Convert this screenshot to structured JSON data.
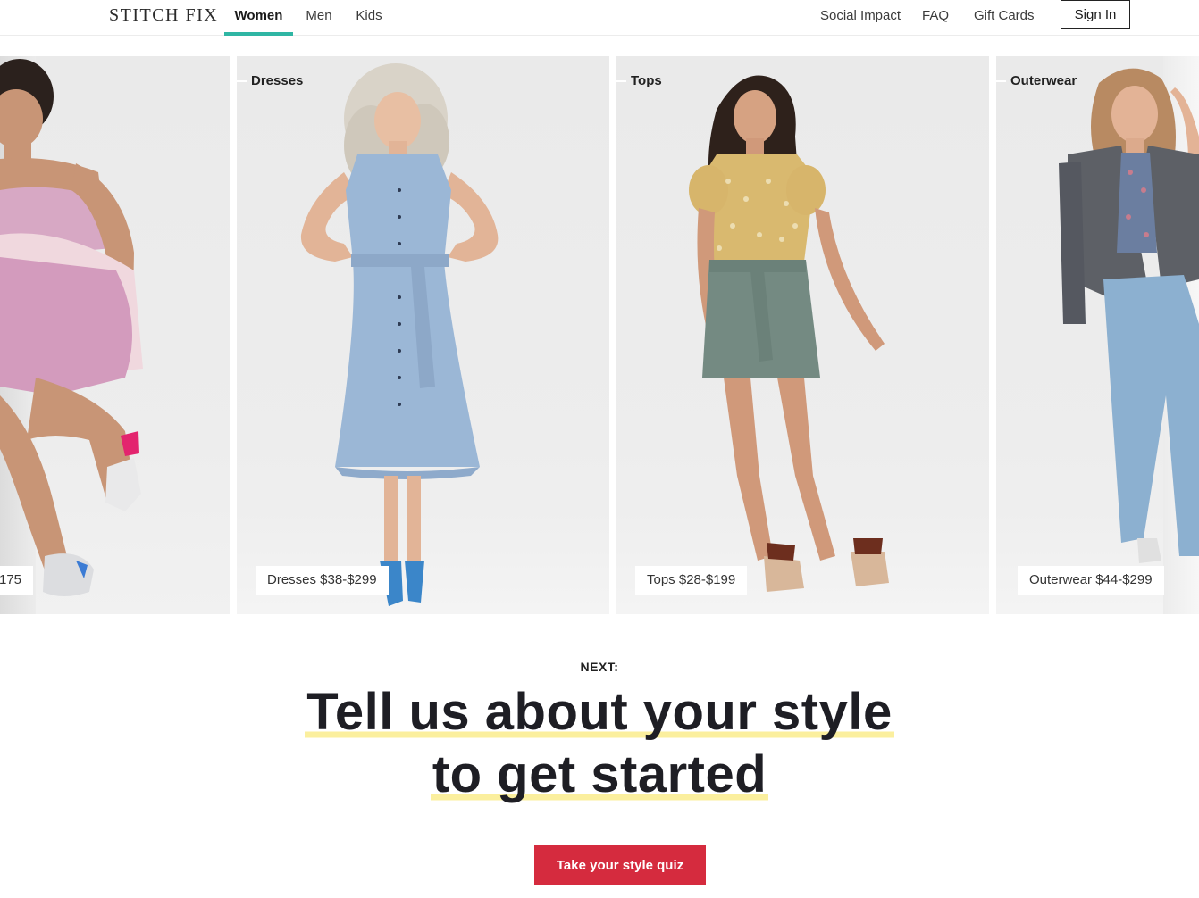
{
  "header": {
    "logo": "STITCH FIX",
    "tabs": [
      {
        "label": "Women",
        "active": true
      },
      {
        "label": "Men",
        "active": false
      },
      {
        "label": "Kids",
        "active": false
      }
    ],
    "links": [
      "Social Impact",
      "FAQ",
      "Gift Cards"
    ],
    "signin_label": "Sign In"
  },
  "carousel": {
    "cards": [
      {
        "category": "",
        "price_label": "175"
      },
      {
        "category": "Dresses",
        "price_label": "Dresses $38-$299"
      },
      {
        "category": "Tops",
        "price_label": "Tops $28-$199"
      },
      {
        "category": "Outerwear",
        "price_label": "Outerwear $44-$299"
      }
    ]
  },
  "cta": {
    "next_label": "NEXT:",
    "headline_line1": "Tell us about your style",
    "headline_line2": "to get started",
    "button_label": "Take your style quiz"
  },
  "colors": {
    "accent_teal": "#2fb6a4",
    "cta_red": "#d52b3e",
    "highlight_yellow": "#fbef9e"
  }
}
